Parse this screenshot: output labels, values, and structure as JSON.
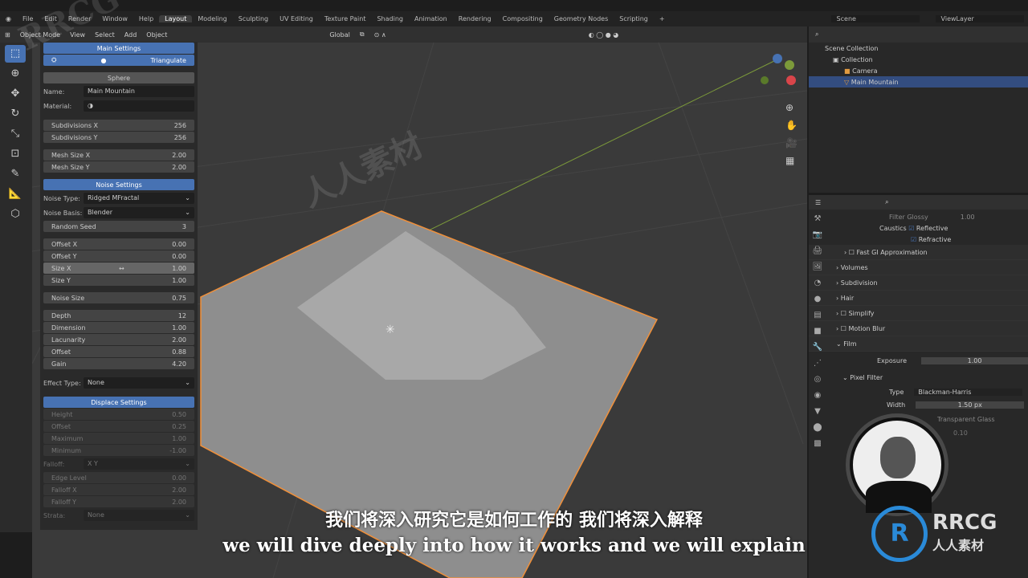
{
  "menu": [
    "File",
    "Edit",
    "Render",
    "Window",
    "Help"
  ],
  "workspaces": [
    "Layout",
    "Modeling",
    "Sculpting",
    "UV Editing",
    "Texture Paint",
    "Shading",
    "Animation",
    "Rendering",
    "Compositing",
    "Geometry Nodes",
    "Scripting"
  ],
  "scene": "Scene",
  "view_layer": "ViewLayer",
  "header": {
    "mode": "Object Mode",
    "items": [
      "View",
      "Select",
      "Add",
      "Object"
    ],
    "orientation": "Global"
  },
  "panel": {
    "main_settings": "Main Settings",
    "triangulate": "Triangulate",
    "sphere": "Sphere",
    "name_label": "Name:",
    "name": "Main Mountain",
    "material_label": "Material:",
    "subdiv": [
      [
        "Subdivisions X",
        "256"
      ],
      [
        "Subdivisions Y",
        "256"
      ]
    ],
    "mesh": [
      [
        "Mesh Size X",
        "2.00"
      ],
      [
        "Mesh Size Y",
        "2.00"
      ]
    ],
    "noise_settings": "Noise Settings",
    "noise_type_label": "Noise Type:",
    "noise_type": "Ridged MFractal",
    "noise_basis_label": "Noise Basis:",
    "noise_basis": "Blender",
    "seed": [
      "Random Seed",
      "3"
    ],
    "offsets": [
      [
        "Offset X",
        "0.00"
      ],
      [
        "Offset Y",
        "0.00"
      ],
      [
        "Size X",
        "1.00"
      ],
      [
        "Size Y",
        "1.00"
      ]
    ],
    "noise_size": [
      "Noise Size",
      "0.75"
    ],
    "params": [
      [
        "Depth",
        "12"
      ],
      [
        "Dimension",
        "1.00"
      ],
      [
        "Lacunarity",
        "2.00"
      ],
      [
        "Offset",
        "0.88"
      ],
      [
        "Gain",
        "4.20"
      ]
    ],
    "effect_label": "Effect Type:",
    "effect": "None",
    "displace_settings": "Displace Settings",
    "displace": [
      [
        "Height",
        "0.50"
      ],
      [
        "Offset",
        "0.25"
      ],
      [
        "Maximum",
        "1.00"
      ],
      [
        "Minimum",
        "-1.00"
      ]
    ],
    "falloff_label": "Falloff:",
    "falloff": "X Y",
    "falloff_rows": [
      [
        "Edge Level",
        "0.00"
      ],
      [
        "Falloff X",
        "2.00"
      ],
      [
        "Falloff Y",
        "2.00"
      ]
    ],
    "strata_label": "Strata:",
    "strata": "None"
  },
  "outliner": {
    "root": "Scene Collection",
    "collection": "Collection",
    "items": [
      "Camera",
      "Main Mountain"
    ]
  },
  "props": {
    "filter_glossy": "Filter Glossy",
    "filter_glossy_val": "1.00",
    "caustics": "Caustics",
    "reflective": "Reflective",
    "refractive": "Refractive",
    "fast_gi": "Fast GI Approximation",
    "sections": [
      "Volumes",
      "Subdivision",
      "Hair",
      "Simplify",
      "Motion Blur"
    ],
    "film": "Film",
    "exposure": "Exposure",
    "exposure_val": "1.00",
    "pixel_filter": "Pixel Filter",
    "type": "Type",
    "type_val": "Blackman-Harris",
    "width": "Width",
    "width_val": "1.50 px",
    "transparent_glass": "Transparent Glass",
    "roughness_val": "0.10"
  },
  "subtitles": {
    "cn": "我们将深入研究它是如何工作的 我们将深入解释",
    "en": "we will dive deeply into how it works and we will explain"
  },
  "watermark": {
    "logo": "RRCG",
    "sub": "人人素材"
  },
  "colors": {
    "accent": "#4772b3",
    "selection": "#f0903a"
  }
}
